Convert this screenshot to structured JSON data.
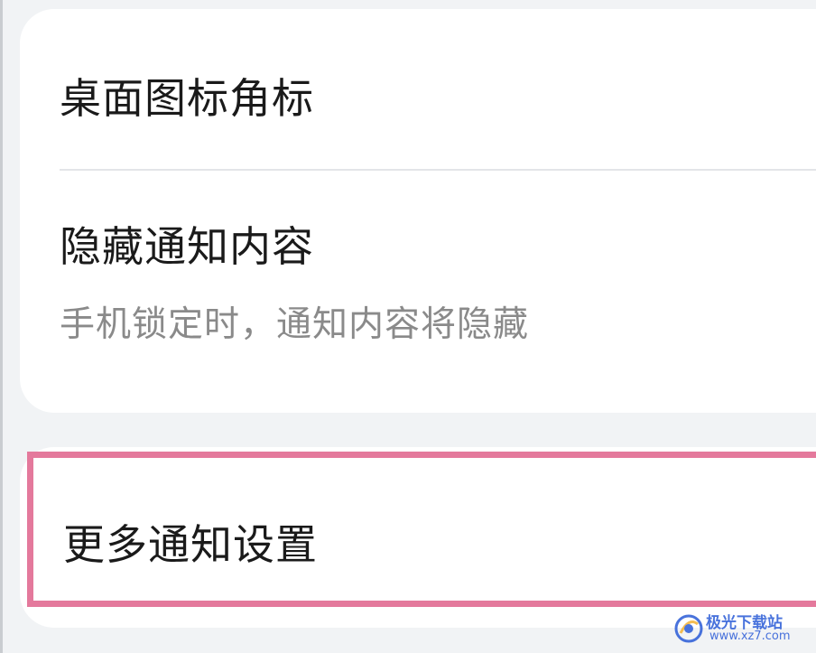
{
  "settings": {
    "items": [
      {
        "title": "桌面图标角标"
      },
      {
        "title": "隐藏通知内容",
        "subtitle": "手机锁定时，通知内容将隐藏"
      },
      {
        "title": "更多通知设置"
      }
    ]
  },
  "highlight": {
    "color": "#e4799c"
  },
  "watermark": {
    "text": "极光下载站",
    "url": "www.xz7.com"
  }
}
